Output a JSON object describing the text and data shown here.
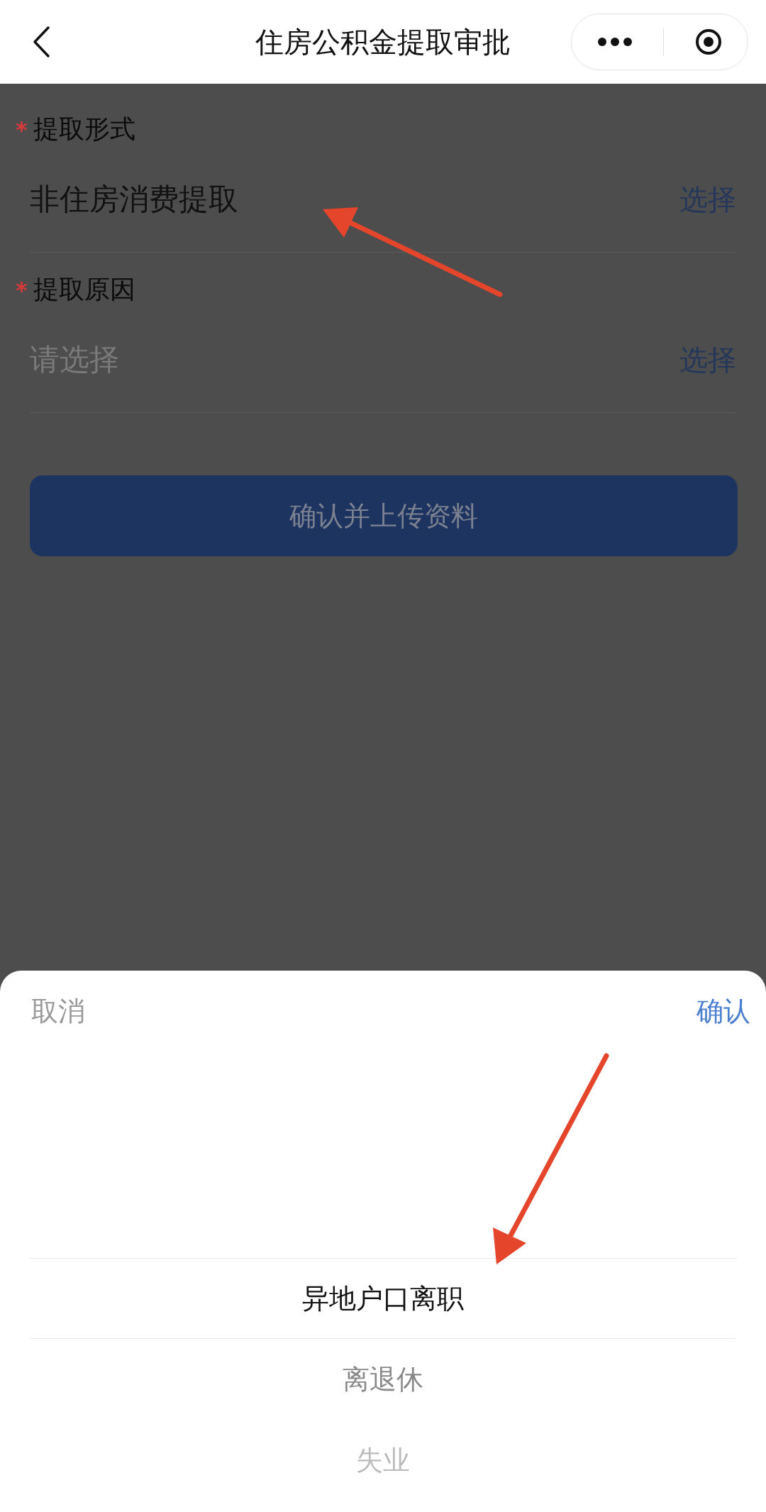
{
  "header": {
    "title": "住房公积金提取审批"
  },
  "form": {
    "fields": [
      {
        "label": "提取形式",
        "required_mark": "*",
        "value": "非住房消费提取",
        "action": "选择"
      },
      {
        "label": "提取原因",
        "required_mark": "*",
        "placeholder": "请选择",
        "action": "选择"
      }
    ],
    "submit_button": "确认并上传资料"
  },
  "picker": {
    "cancel": "取消",
    "confirm": "确认",
    "options": [
      {
        "label": "异地户口离职",
        "selected": true
      },
      {
        "label": "离退休",
        "selected": false
      },
      {
        "label": "失业",
        "selected": false
      }
    ]
  }
}
